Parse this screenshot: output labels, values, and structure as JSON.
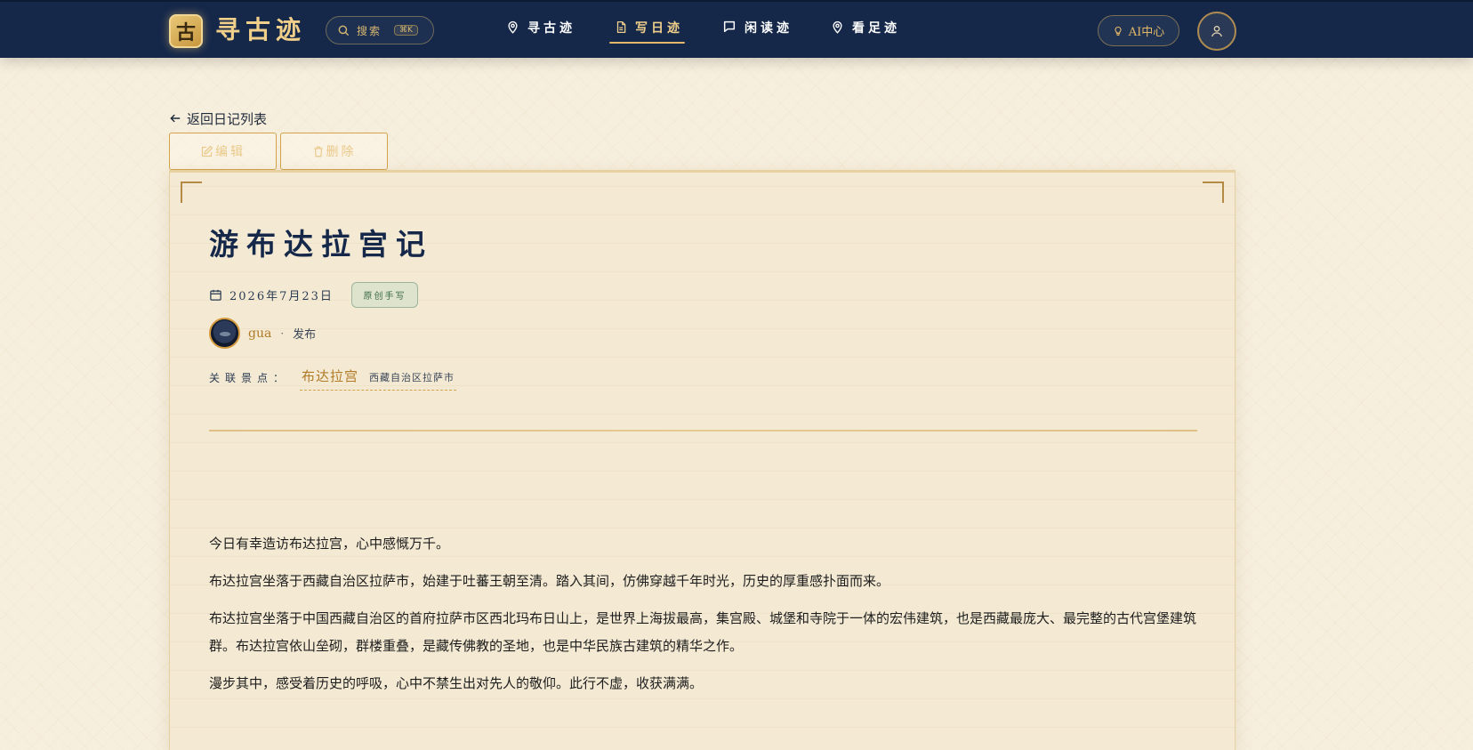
{
  "nav": {
    "logo_char": "古",
    "brand": "寻古迹",
    "search_label": "搜索",
    "search_shortcut": "⌘K",
    "items": [
      {
        "label": "寻古迹",
        "icon": "map-pin-icon"
      },
      {
        "label": "写日迹",
        "icon": "document-icon",
        "active": true
      },
      {
        "label": "闲读迹",
        "icon": "chat-bubble-icon"
      },
      {
        "label": "看足迹",
        "icon": "map-pin-icon"
      }
    ],
    "ai_label": "AI中心",
    "user_icon": "user-icon"
  },
  "page": {
    "back_label": "返回日记列表",
    "edit_label": "编辑",
    "delete_label": "删除"
  },
  "diary": {
    "title": "游布达拉宫记",
    "date": "2026年7月23日",
    "tag": "原创手写",
    "author": "gua",
    "author_sep": "·",
    "author_action": "发布",
    "related_label": "关联景点：",
    "related_name": "布达拉宫",
    "related_location": "西藏自治区拉萨市",
    "paragraphs": [
      "今日有幸造访布达拉宫，心中感慨万千。",
      "布达拉宫坐落于西藏自治区拉萨市，始建于吐蕃王朝至清。踏入其间，仿佛穿越千年时光，历史的厚重感扑面而来。",
      "布达拉宫坐落于中国西藏自治区的首府拉萨市区西北玛布日山上，是世界上海拔最高，集宫殿、城堡和寺院于一体的宏伟建筑，也是西藏最庞大、最完整的古代宫堡建筑群。布达拉宫依山垒砌，群楼重叠，是藏传佛教的圣地，也是中华民族古建筑的精华之作。",
      "漫步其中，感受着历史的呼吸，心中不禁生出对先人的敬仰。此行不虚，收获满满。"
    ]
  },
  "colors": {
    "nav_bg": "#15284a",
    "gold": "#e2b869",
    "brown_accent": "#b07a26",
    "page_bg": "#f7efde",
    "card_bg": "#f4ead4",
    "tag_green": "#3c6a4a"
  }
}
